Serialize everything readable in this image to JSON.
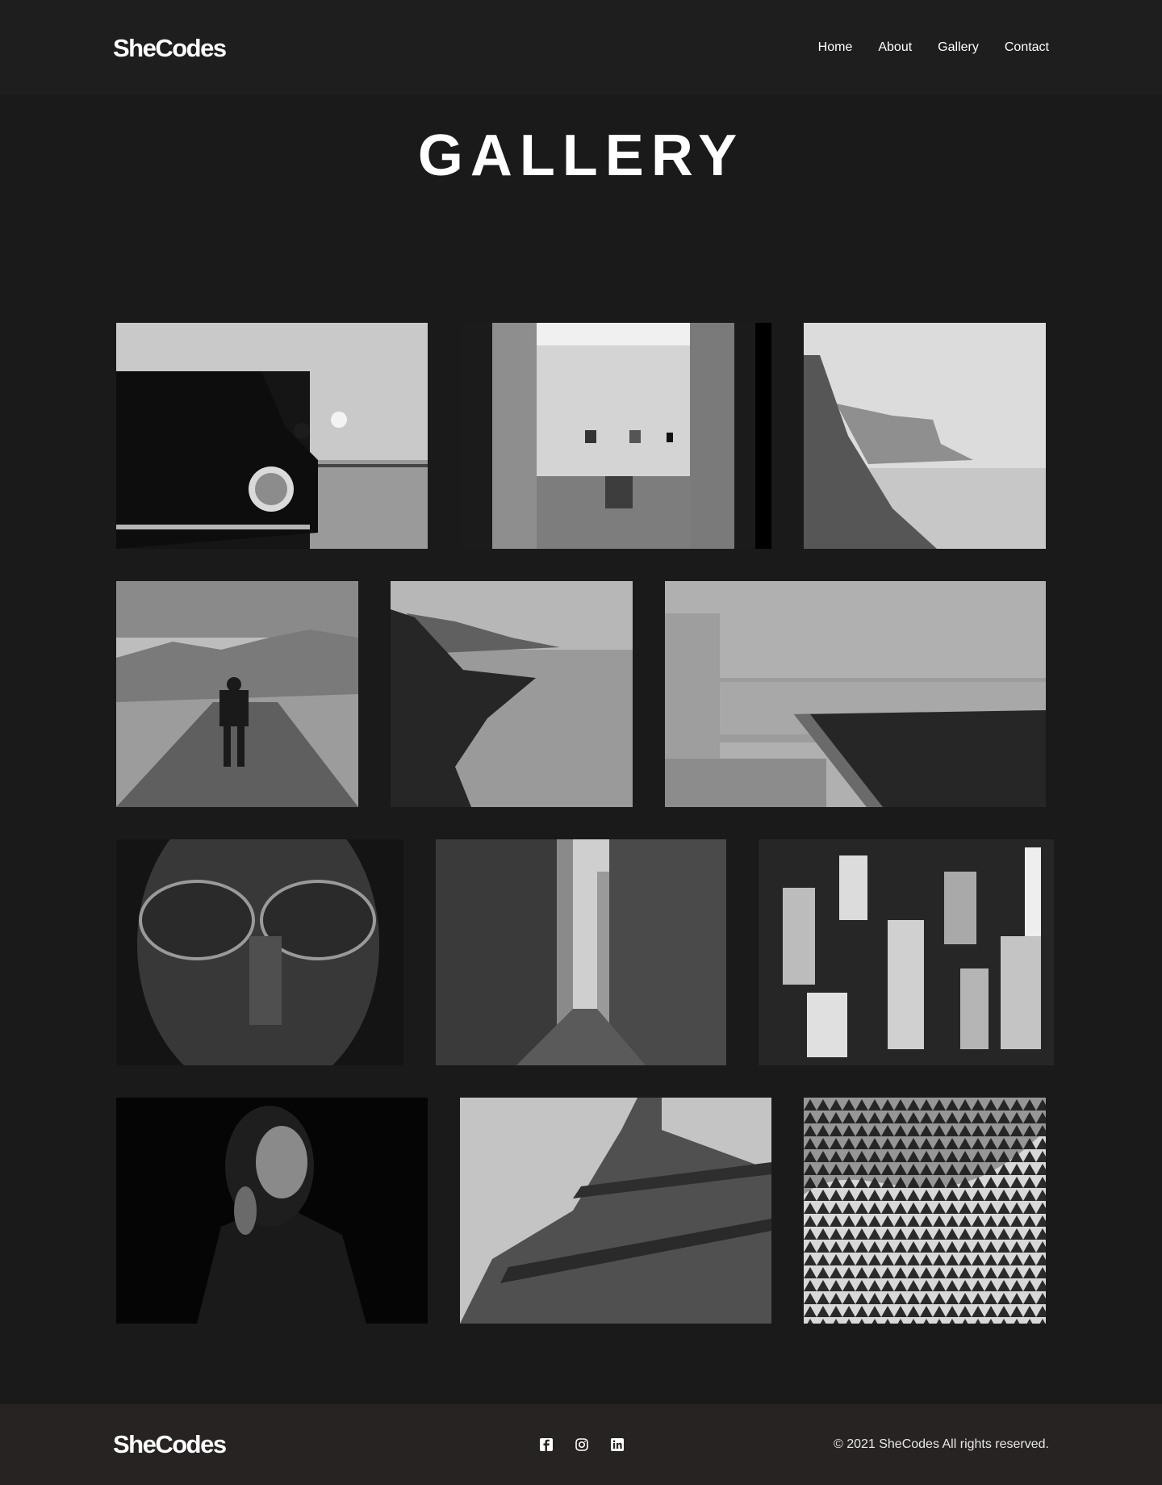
{
  "brand": {
    "logo": "SheCodes"
  },
  "nav": {
    "items": [
      "Home",
      "About",
      "Gallery",
      "Contact"
    ]
  },
  "page": {
    "title": "GALLERY"
  },
  "gallery": {
    "photos": [
      "vintage-car-photo",
      "gallery-doorway-photo",
      "coastal-cliff-photo",
      "man-on-road-photo",
      "lake-shore-photo",
      "concrete-stairs-photo",
      "man-with-glasses-photo",
      "city-street-photo",
      "aerial-city-photo",
      "woman-portrait-photo",
      "eiffel-tower-photo",
      "pattern-facade-photo"
    ]
  },
  "footer": {
    "logo": "SheCodes",
    "social_icons": [
      "facebook-icon",
      "instagram-icon",
      "linkedin-icon"
    ],
    "copyright": "© 2021 SheCodes All rights reserved."
  }
}
